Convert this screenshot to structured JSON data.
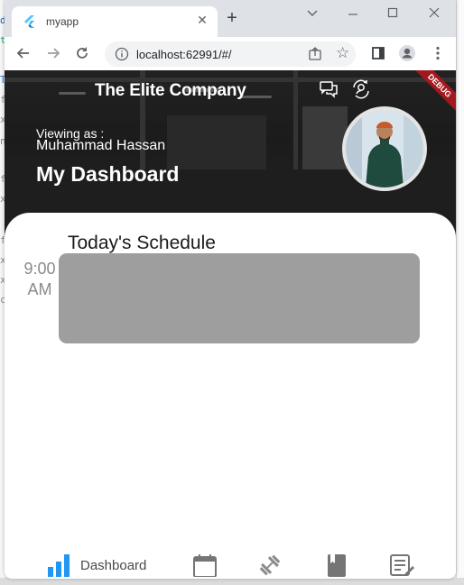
{
  "browser": {
    "tab_title": "myapp",
    "url": "localhost:62991/#/"
  },
  "app": {
    "brand": "The Elite Company",
    "debug_banner": "DEBUG",
    "viewing_as_label": "Viewing as :",
    "viewer_name": "Muhammad Hassan",
    "page_title": "My Dashboard",
    "icons": {
      "messages": "chat-bubbles-icon",
      "switch_user": "person-sync-icon"
    }
  },
  "schedule": {
    "title": "Today's Schedule",
    "items": [
      {
        "time_hour": "9:00",
        "time_period": "AM"
      }
    ]
  },
  "bottom_nav": {
    "items": [
      {
        "icon": "bar-chart-icon",
        "label": "Dashboard",
        "active": true
      },
      {
        "icon": "calendar-icon",
        "label": ""
      },
      {
        "icon": "dumbbell-icon",
        "label": ""
      },
      {
        "icon": "book-icon",
        "label": ""
      },
      {
        "icon": "notes-edit-icon",
        "label": ""
      }
    ]
  },
  "colors": {
    "accent": "#2196f3",
    "debug_ribbon": "#a3181f",
    "slot_fill": "#9e9e9e"
  }
}
